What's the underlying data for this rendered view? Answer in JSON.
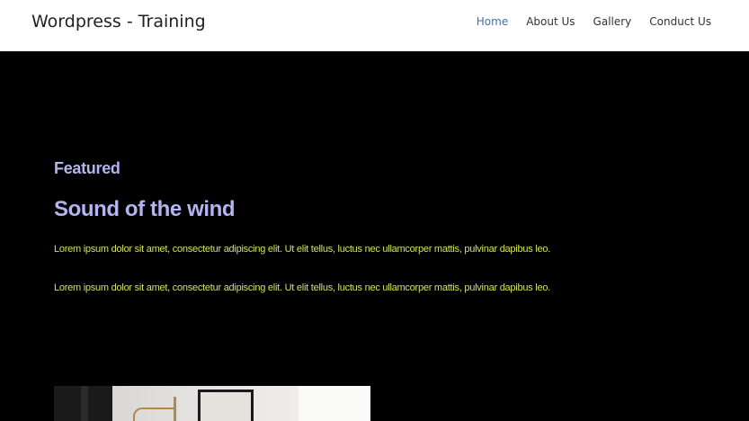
{
  "header": {
    "site_title": "Wordpress - Training",
    "nav": [
      {
        "label": "Home",
        "active": true
      },
      {
        "label": "About Us",
        "active": false
      },
      {
        "label": "Gallery",
        "active": false
      },
      {
        "label": "Conduct Us",
        "active": false
      }
    ]
  },
  "hero": {
    "eyebrow": "Featured",
    "title": "Sound of the wind",
    "paragraphs": [
      "Lorem ipsum dolor sit amet, consectetur adipiscing elit. Ut elit tellus, luctus nec ullamcorper mattis, pulvinar dapibus leo.",
      "Lorem ipsum dolor sit amet, consectetur adipiscing elit. Ut elit tellus, luctus nec ullamcorper mattis, pulvinar dapibus leo."
    ]
  },
  "colors": {
    "heading": "#b4b4f0",
    "body_text": "#d6e25a",
    "nav_active": "#3d6fb0",
    "background": "#000000"
  }
}
